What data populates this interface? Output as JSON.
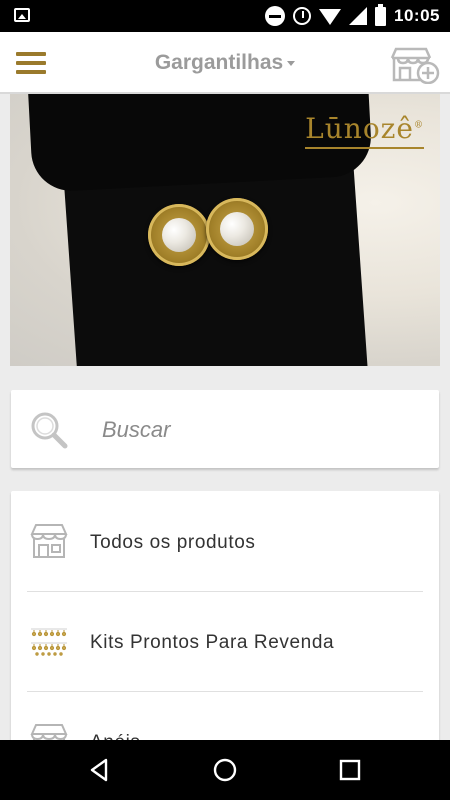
{
  "status_bar": {
    "time": "10:05",
    "icons": [
      "gallery-icon",
      "do-not-disturb-icon",
      "alarm-icon",
      "wifi-icon",
      "signal-icon",
      "battery-icon"
    ]
  },
  "app_bar": {
    "title": "Gargantilhas",
    "menu_icon": "hamburger-icon",
    "action_icon": "add-store-icon"
  },
  "banner": {
    "brand": "Lūnozê"
  },
  "search": {
    "placeholder": "Buscar",
    "icon": "search-icon"
  },
  "menu": {
    "items": [
      {
        "label": "Todos os produtos",
        "icon": "store-icon"
      },
      {
        "label": "Kits Prontos Para Revenda",
        "icon": "jewelry-kit-icon"
      },
      {
        "label": "Anéis",
        "icon": "store-icon"
      }
    ]
  },
  "nav_bar": {
    "buttons": [
      "back-icon",
      "home-icon",
      "recents-icon"
    ]
  },
  "colors": {
    "accent": "#9a7a2c",
    "title_gray": "#9b9b9b",
    "background": "#ececec"
  }
}
